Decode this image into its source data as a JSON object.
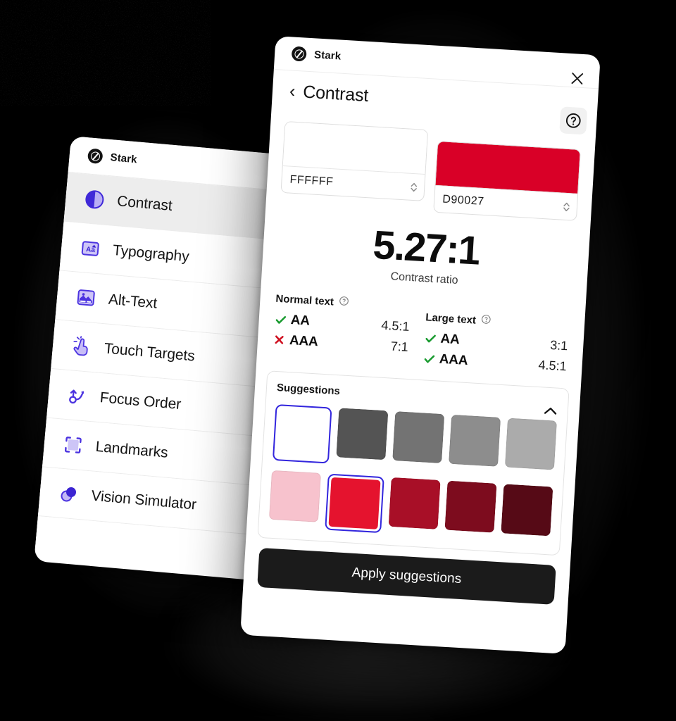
{
  "brand": {
    "name": "Stark",
    "logo_icon": "stark-logo-icon"
  },
  "sidebar": {
    "items": [
      {
        "label": "Contrast",
        "icon": "contrast-circle-icon",
        "active": true
      },
      {
        "label": "Typography",
        "icon": "typography-aa-icon",
        "active": false
      },
      {
        "label": "Alt-Text",
        "icon": "image-alt-text-icon",
        "active": false
      },
      {
        "label": "Touch Targets",
        "icon": "pointing-hand-icon",
        "active": false
      },
      {
        "label": "Focus Order",
        "icon": "focus-order-arrow-icon",
        "active": false
      },
      {
        "label": "Landmarks",
        "icon": "landmarks-frame-icon",
        "active": false
      },
      {
        "label": "Vision Simulator",
        "icon": "vision-simulator-icon",
        "active": false
      }
    ]
  },
  "detail": {
    "title": "Contrast",
    "back_icon": "chevron-left-icon",
    "close_icon": "close-icon",
    "help_icon": "help-question-icon",
    "colors": {
      "foreground": {
        "hex_label": "FFFFFF",
        "preview": "#ffffff",
        "stepper_icon": "stepper-updown-icon"
      },
      "background": {
        "hex_label": "D90027",
        "preview": "#d90027",
        "stepper_icon": "stepper-updown-icon"
      }
    },
    "ratio": {
      "value": "5.27:1",
      "caption": "Contrast ratio"
    },
    "compliance": {
      "normal": {
        "heading": "Normal text",
        "info_icon": "info-question-icon",
        "rows": [
          {
            "level": "AA",
            "ratio": "4.5:1",
            "pass": true,
            "mark_icon": "check-icon"
          },
          {
            "level": "AAA",
            "ratio": "7:1",
            "pass": false,
            "mark_icon": "cross-icon"
          }
        ]
      },
      "large": {
        "heading": "Large text",
        "info_icon": "info-question-icon",
        "rows": [
          {
            "level": "AA",
            "ratio": "3:1",
            "pass": true,
            "mark_icon": "check-icon"
          },
          {
            "level": "AAA",
            "ratio": "4.5:1",
            "pass": true,
            "mark_icon": "check-icon"
          }
        ]
      }
    },
    "suggestions": {
      "title": "Suggestions",
      "collapse_icon": "chevron-up-icon",
      "rows": [
        {
          "swatches": [
            {
              "color": "#ffffff",
              "selected": true
            },
            {
              "color": "#545454",
              "selected": false
            },
            {
              "color": "#737373",
              "selected": false
            },
            {
              "color": "#8d8d8d",
              "selected": false
            },
            {
              "color": "#ababab",
              "selected": false
            }
          ]
        },
        {
          "swatches": [
            {
              "color": "#f7c2cd",
              "selected": false
            },
            {
              "color": "#e5132e",
              "selected": true
            },
            {
              "color": "#a80f27",
              "selected": false
            },
            {
              "color": "#7d0c1e",
              "selected": false
            },
            {
              "color": "#560a16",
              "selected": false
            }
          ]
        }
      ],
      "apply_label": "Apply suggestions"
    },
    "accent_selected": "#3225dd"
  },
  "theme": {
    "background": "#000000",
    "panel": "#ffffff",
    "active_row": "#ededed",
    "pass_color": "#1a9b30",
    "fail_color": "#cf1020",
    "purple_icon": "#4f37e0",
    "button_dark": "#1b1b1b"
  }
}
